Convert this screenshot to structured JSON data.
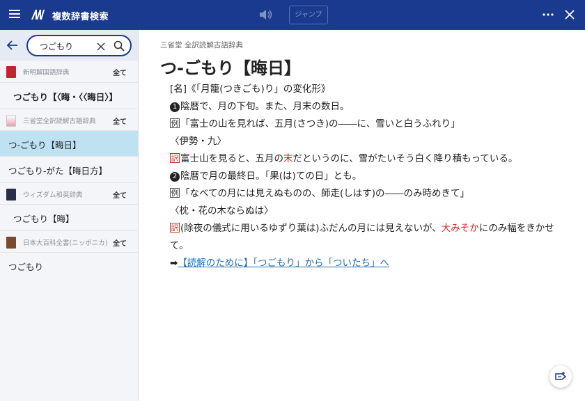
{
  "app": {
    "title": "複数辞書検索",
    "jump_label": "ジャンプ"
  },
  "search": {
    "value": "つごもり",
    "placeholder": ""
  },
  "colors": {
    "header": "#1a3a8f",
    "selected": "#bfe2f2",
    "accent_red": "#d22",
    "link": "#1f6fb0"
  },
  "groups": [
    {
      "dict": "新明解国語辞典",
      "all_label": "全て",
      "icon": "red-book-icon",
      "results": [
        {
          "label": "つごもり【〈晦・〈〈晦日〉】",
          "selected": false
        }
      ]
    },
    {
      "dict": "三省堂全訳読解古語辞典",
      "all_label": "全て",
      "icon": "flower-book-icon",
      "results": [
        {
          "label": "つ-ごもり【晦日】",
          "selected": true
        },
        {
          "label": "つごもり-がた【晦日方】",
          "selected": false
        }
      ]
    },
    {
      "dict": "ウィズダム和英辞典",
      "all_label": "全て",
      "icon": "dark-book-icon",
      "results": [
        {
          "label": "つごもり【晦】",
          "selected": false
        }
      ]
    },
    {
      "dict": "日本大百科全書(ニッポニカ)",
      "all_label": "全て",
      "icon": "brown-book-icon",
      "results": [
        {
          "label": "つごもり",
          "selected": false
        }
      ]
    }
  ],
  "entry": {
    "source": "三省堂 全訳読解古語辞典",
    "headword": "つ-ごもり【晦日】",
    "pos_line": "[名]《「月籠(つきごも)り」の変化形》",
    "sense1": {
      "num": "❶",
      "text": "陰暦で、月の下旬。また、月末の数日。"
    },
    "ex1": {
      "mark": "例",
      "text": "「富士の山を見れば、五月(さつき)の――に、雪いと白うふれり」"
    },
    "src1": "〈伊勢・九〉",
    "tr1": {
      "mark": "訳",
      "pre": "富士山を見ると、五月の",
      "em": "末",
      "post": "だというのに、雪がたいそう白く降り積もっている。"
    },
    "sense2": {
      "num": "❷",
      "text": "陰暦で月の最終日。「果(は)ての日」とも。"
    },
    "ex2": {
      "mark": "例",
      "text": "「なべての月には見えぬものの、師走(しはす)の――のみ時めきて」"
    },
    "src2": "〈枕・花の木ならぬは〉",
    "tr2": {
      "mark": "訳",
      "pre": "(除夜の儀式に用いるゆずり葉は)ふだんの月には見えないが、",
      "em": "大みそか",
      "post": "にのみ幅をきかせて。"
    },
    "ref": {
      "arrow": "➡",
      "text": "【読解のために】「つごもり」から「ついたち」へ"
    }
  }
}
